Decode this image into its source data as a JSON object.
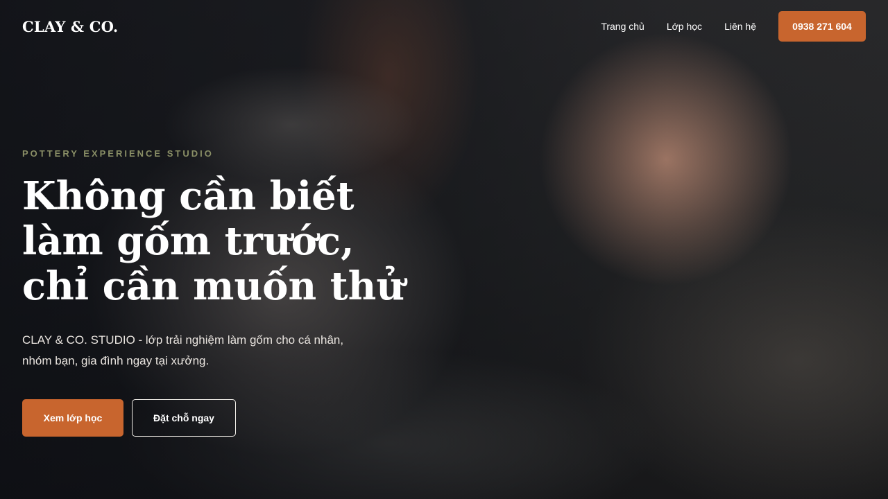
{
  "header": {
    "logo": "CLAY & CO.",
    "nav": [
      {
        "label": "Trang chủ"
      },
      {
        "label": "Lớp học"
      },
      {
        "label": "Liên hệ"
      }
    ],
    "phone_button": "0938 271 604"
  },
  "hero": {
    "eyebrow": "POTTERY EXPERIENCE STUDIO",
    "title": "Không cần biết làm gốm trước, chỉ cần muốn thử",
    "description": "CLAY & CO. STUDIO - lớp trải nghiệm làm gốm cho cá nhân, nhóm bạn, gia đình ngay tại xưởng.",
    "primary_cta": "Xem lớp học",
    "secondary_cta": "Đặt chỗ ngay",
    "background_image": "pottery-wheel-hands-photo"
  },
  "colors": {
    "accent": "#c8652e",
    "eyebrow": "#8a8f66"
  }
}
